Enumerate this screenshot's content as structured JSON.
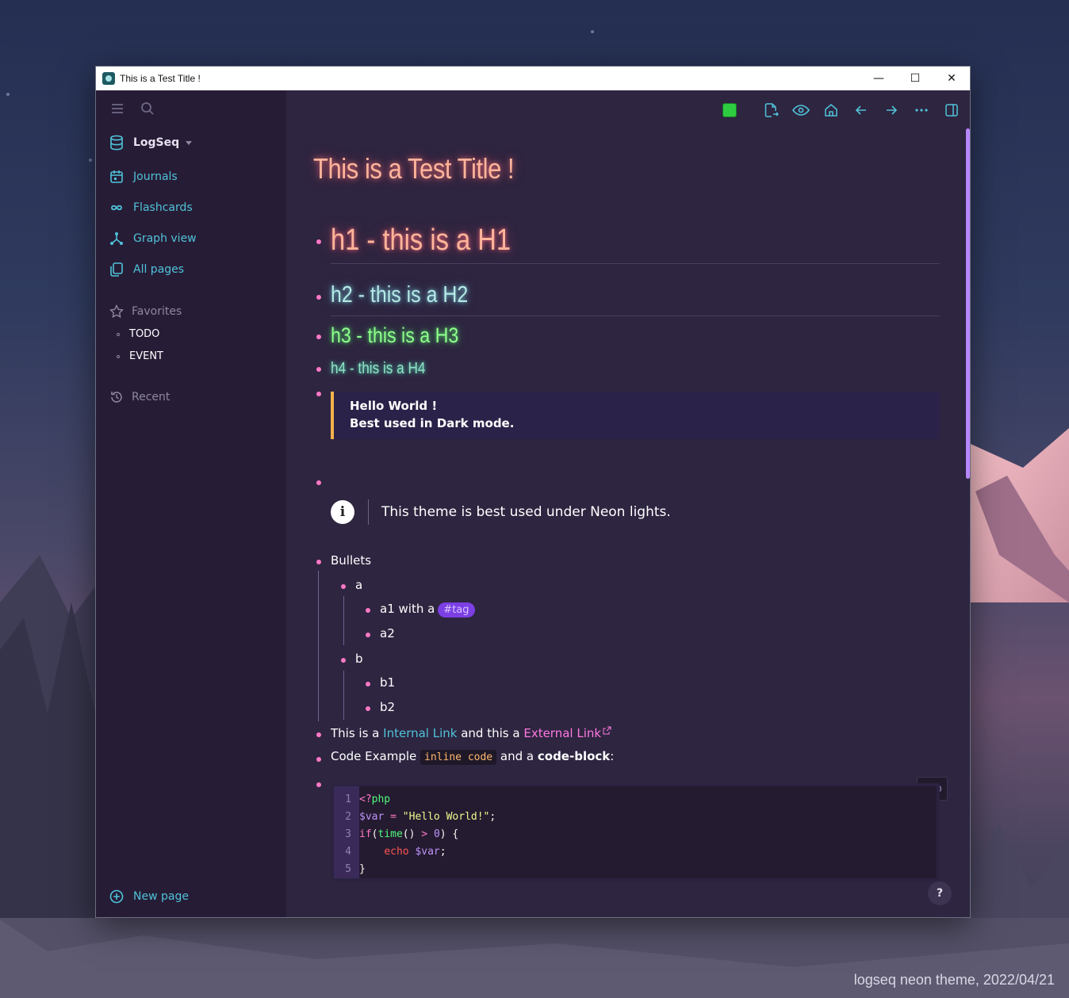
{
  "window": {
    "title": "This is a Test Title !",
    "controls": {
      "minimize": "—",
      "maximize": "☐",
      "close": "✕"
    }
  },
  "sidebar": {
    "graph_name": "LogSeq",
    "nav": [
      {
        "label": "Journals",
        "icon": "calendar-icon"
      },
      {
        "label": "Flashcards",
        "icon": "infinity-icon"
      },
      {
        "label": "Graph view",
        "icon": "graph-icon"
      },
      {
        "label": "All pages",
        "icon": "pages-icon"
      }
    ],
    "favorites_label": "Favorites",
    "favorites": [
      "TODO",
      "EVENT"
    ],
    "recent_label": "Recent",
    "new_page_label": "New page"
  },
  "toolbar": {
    "theme_color": "#2ecc40",
    "icons": [
      "green-square-icon",
      "page-export-icon",
      "eye-icon",
      "home-icon",
      "arrow-left-icon",
      "arrow-right-icon",
      "more-icon",
      "right-sidebar-icon"
    ]
  },
  "page": {
    "title": "This is a Test Title !",
    "h1": "h1 - this is a H1",
    "h2": "h2 - this is a H2",
    "h3": "h3 - this is a H3",
    "h4": "h4 - this is a H4",
    "quote": {
      "line1": "Hello World !",
      "line2": "Best used in Dark mode."
    },
    "callout": {
      "icon": "i",
      "text": "This theme is best used under Neon lights."
    },
    "bullets": {
      "label": "Bullets",
      "a": "a",
      "a1_text": "a1 with a",
      "a1_tag": "#tag",
      "a2": "a2",
      "b": "b",
      "b1": "b1",
      "b2": "b2"
    },
    "links": {
      "prefix": "This is a",
      "internal": "Internal Link",
      "middle": "and this a",
      "external": "External Link"
    },
    "code_example": {
      "prefix": "Code Example",
      "inline": "inline code",
      "middle": "and a",
      "bold": "code-block",
      "suffix": ":"
    },
    "code_block": {
      "lang": "php",
      "line_numbers": [
        "1",
        "2",
        "3",
        "4",
        "5"
      ],
      "lines": [
        "<?php",
        "$var = \"Hello World!\";",
        "if(time() > 0) {",
        "    echo $var;",
        "}"
      ]
    },
    "help": "?"
  },
  "caption": "logseq neon theme, 2022/04/21",
  "colors": {
    "accent_cyan": "#4fc3d9",
    "bullet_pink": "#ff79c6",
    "scrollbar": "#b787ff",
    "quote_border": "#f6b24a"
  }
}
